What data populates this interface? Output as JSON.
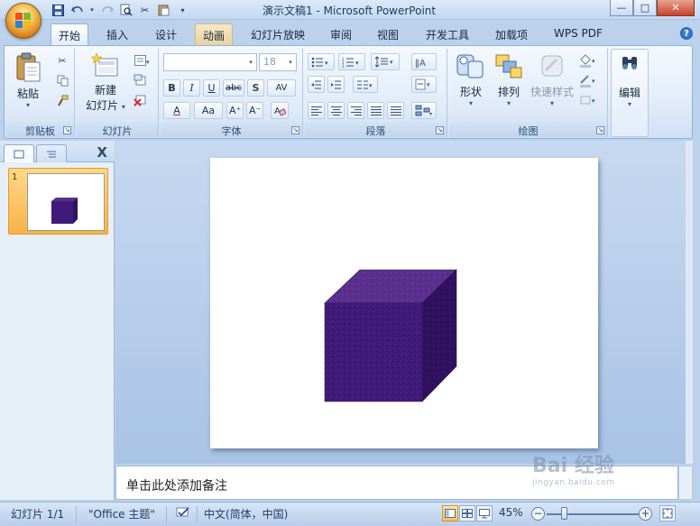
{
  "window": {
    "title": "演示文稿1 - Microsoft PowerPoint",
    "controls": [
      "—",
      "□",
      "✕"
    ]
  },
  "quick_access": [
    "save-icon",
    "undo-icon",
    "redo-icon",
    "print-preview-icon",
    "customize-icon"
  ],
  "ribbon": {
    "tabs": [
      "开始",
      "插入",
      "设计",
      "动画",
      "幻灯片放映",
      "审阅",
      "视图",
      "开发工具",
      "加载项",
      "WPS PDF"
    ],
    "active_tab": "开始",
    "help": "?",
    "clipboard": {
      "label": "剪贴板",
      "paste": "粘贴"
    },
    "slides": {
      "label": "幻灯片",
      "new_slide_line1": "新建",
      "new_slide_line2": "幻灯片"
    },
    "font": {
      "label": "字体",
      "font_name": "",
      "font_size": "18",
      "buttons": [
        "B",
        "I",
        "U",
        "abc",
        "S",
        "AV",
        "A",
        "Aa",
        "A⁺",
        "A⁻"
      ]
    },
    "paragraph": {
      "label": "段落"
    },
    "drawing": {
      "label": "绘图",
      "shapes": "形状",
      "arrange": "排列",
      "quick_styles": "快速样式"
    },
    "editing": {
      "label": "编辑"
    }
  },
  "left_pane": {
    "slide_number": "1",
    "close": "X"
  },
  "slide": {
    "shape": "cube",
    "shape_color": "#3f1a78",
    "shape_top_color": "#5a2f8e",
    "shape_side_color": "#2f115e"
  },
  "notes": {
    "placeholder": "单击此处添加备注"
  },
  "status_bar": {
    "slide_info": "幻灯片 1/1",
    "theme": "\"Office 主题\"",
    "language": "中文(简体，中国)",
    "zoom": "45%",
    "zoom_fraction": 0.45
  },
  "watermark": {
    "text": "Bai 经验",
    "url": "jingyan.baidu.com"
  }
}
